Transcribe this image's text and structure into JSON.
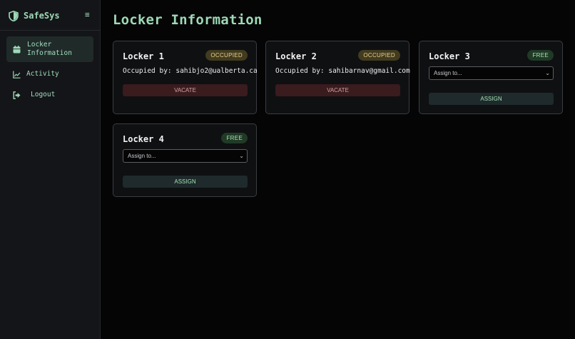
{
  "app": {
    "name": "SafeSys"
  },
  "sidebar": {
    "items": [
      {
        "label": "Locker Information",
        "icon": "calendar-icon",
        "active": true
      },
      {
        "label": "Activity",
        "icon": "chart-line-icon",
        "active": false
      },
      {
        "label": "Logout",
        "icon": "logout-icon",
        "active": false
      }
    ]
  },
  "page": {
    "title": "Locker Information"
  },
  "lockers": [
    {
      "name": "Locker 1",
      "status": "OCCUPIED",
      "occupant_text": "Occupied by: sahibjo2@ualberta.ca",
      "action": "VACATE"
    },
    {
      "name": "Locker 2",
      "status": "OCCUPIED",
      "occupant_text": "Occupied by: sahibarnav@gmail.com",
      "action": "VACATE"
    },
    {
      "name": "Locker 3",
      "status": "FREE",
      "select_value": "Assign to...",
      "action": "ASSIGN"
    },
    {
      "name": "Locker 4",
      "status": "FREE",
      "select_value": "Assign to...",
      "action": "ASSIGN"
    }
  ],
  "colors": {
    "accent": "#9ed9b6",
    "occupied_badge": "#423b1f",
    "free_badge": "#203a26",
    "vacate_button": "#3a1b1e",
    "assign_button": "#1e2a2b"
  }
}
